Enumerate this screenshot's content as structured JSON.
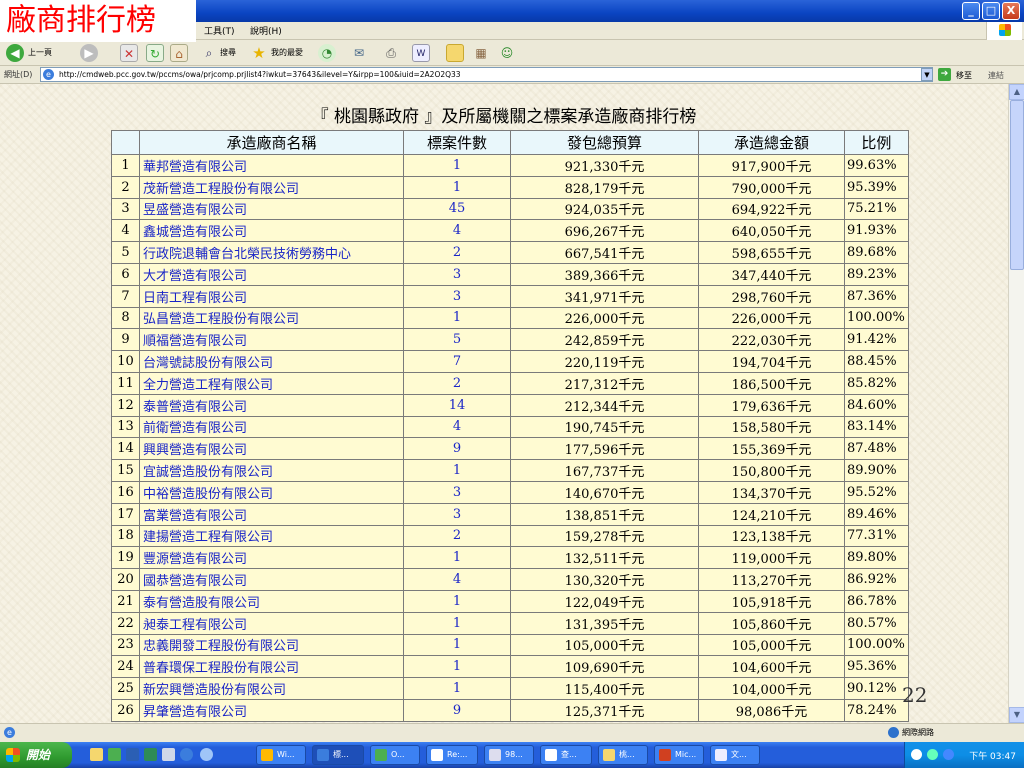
{
  "slide": {
    "title": "廠商排行榜",
    "page_number": "22"
  },
  "window": {
    "minimize": "_",
    "maximize": "□",
    "close": "X"
  },
  "menu": {
    "tools": "工具(T)",
    "help": "說明(H)"
  },
  "toolbar": {
    "back_label": "上一頁",
    "search_label": "搜尋",
    "favorites_label": "我的最愛"
  },
  "address": {
    "label": "網址(D)",
    "url": "http://cmdweb.pcc.gov.tw/pccms/owa/prjcomp.prjlist4?iwkut=37643&ilevel=Y&irpp=100&iuid=2A2O2Q33",
    "go_label": "移至",
    "links_label": "連結"
  },
  "page": {
    "heading": "『 桃園縣政府 』及所屬機關之標案承造廠商排行榜",
    "columns": [
      "",
      "承造廠商名稱",
      "標案件數",
      "發包總預算",
      "承造總金額",
      "比例"
    ],
    "rows": [
      [
        "1",
        "華邦營造有限公司",
        "1",
        "921,330千元",
        "917,900千元",
        "99.63%"
      ],
      [
        "2",
        "茂新營造工程股份有限公司",
        "1",
        "828,179千元",
        "790,000千元",
        "95.39%"
      ],
      [
        "3",
        "昱盛營造有限公司",
        "45",
        "924,035千元",
        "694,922千元",
        "75.21%"
      ],
      [
        "4",
        "鑫城營造有限公司",
        "4",
        "696,267千元",
        "640,050千元",
        "91.93%"
      ],
      [
        "5",
        "行政院退輔會台北榮民技術勞務中心",
        "2",
        "667,541千元",
        "598,655千元",
        "89.68%"
      ],
      [
        "6",
        "大才營造有限公司",
        "3",
        "389,366千元",
        "347,440千元",
        "89.23%"
      ],
      [
        "7",
        "日南工程有限公司",
        "3",
        "341,971千元",
        "298,760千元",
        "87.36%"
      ],
      [
        "8",
        "弘昌營造工程股份有限公司",
        "1",
        "226,000千元",
        "226,000千元",
        "100.00%"
      ],
      [
        "9",
        "順福營造有限公司",
        "5",
        "242,859千元",
        "222,030千元",
        "91.42%"
      ],
      [
        "10",
        "台灣號誌股份有限公司",
        "7",
        "220,119千元",
        "194,704千元",
        "88.45%"
      ],
      [
        "11",
        "全力營造工程有限公司",
        "2",
        "217,312千元",
        "186,500千元",
        "85.82%"
      ],
      [
        "12",
        "泰普營造有限公司",
        "14",
        "212,344千元",
        "179,636千元",
        "84.60%"
      ],
      [
        "13",
        "前衛營造有限公司",
        "4",
        "190,745千元",
        "158,580千元",
        "83.14%"
      ],
      [
        "14",
        "興興營造有限公司",
        "9",
        "177,596千元",
        "155,369千元",
        "87.48%"
      ],
      [
        "15",
        "宜誠營造股份有限公司",
        "1",
        "167,737千元",
        "150,800千元",
        "89.90%"
      ],
      [
        "16",
        "中裕營造股份有限公司",
        "3",
        "140,670千元",
        "134,370千元",
        "95.52%"
      ],
      [
        "17",
        "富業營造有限公司",
        "3",
        "138,851千元",
        "124,210千元",
        "89.46%"
      ],
      [
        "18",
        "建揚營造工程有限公司",
        "2",
        "159,278千元",
        "123,138千元",
        "77.31%"
      ],
      [
        "19",
        "豐源營造有限公司",
        "1",
        "132,511千元",
        "119,000千元",
        "89.80%"
      ],
      [
        "20",
        "國恭營造有限公司",
        "4",
        "130,320千元",
        "113,270千元",
        "86.92%"
      ],
      [
        "21",
        "泰有營造股有限公司",
        "1",
        "122,049千元",
        "105,918千元",
        "86.78%"
      ],
      [
        "22",
        "昶泰工程有限公司",
        "1",
        "131,395千元",
        "105,860千元",
        "80.57%"
      ],
      [
        "23",
        "忠義開發工程股份有限公司",
        "1",
        "105,000千元",
        "105,000千元",
        "100.00%"
      ],
      [
        "24",
        "普春環保工程股份有限公司",
        "1",
        "109,690千元",
        "104,600千元",
        "95.36%"
      ],
      [
        "25",
        "新宏興營造股份有限公司",
        "1",
        "115,400千元",
        "104,000千元",
        "90.12%"
      ],
      [
        "26",
        "昇肇營造有限公司",
        "9",
        "125,371千元",
        "98,086千元",
        "78.24%"
      ]
    ]
  },
  "status": {
    "zone": "網際網路"
  },
  "taskbar": {
    "start_label": "開始",
    "buttons": [
      "Wi...",
      "標...",
      "O...",
      "Re:...",
      "98...",
      "查...",
      "桃...",
      "Mic...",
      "文..."
    ],
    "clock": "下午 03:47"
  },
  "colors": {
    "link_blue": "#1a25c7",
    "cell_yellow": "#fffbd2",
    "header_cyan": "#e9f7fb",
    "title_red": "#ff0000"
  }
}
